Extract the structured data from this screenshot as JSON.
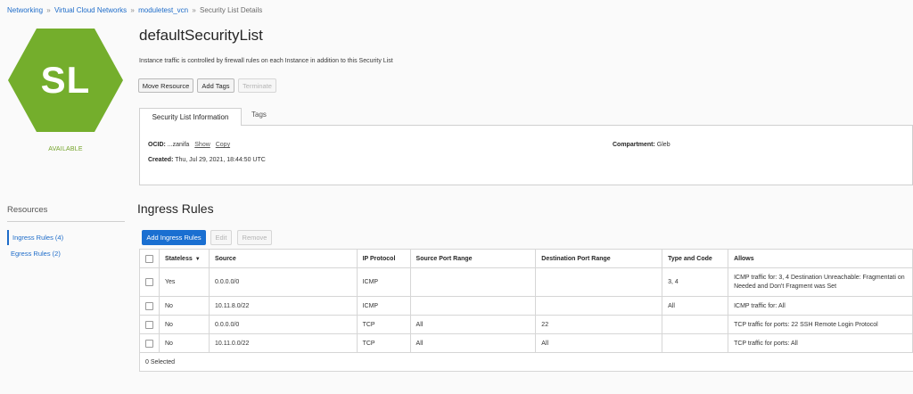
{
  "breadcrumb": {
    "items": [
      "Networking",
      "Virtual Cloud Networks",
      "moduletest_vcn"
    ],
    "current": "Security List Details",
    "separator": "»"
  },
  "logo": {
    "initials": "SL",
    "color": "#74ae2c",
    "status": "AVAILABLE"
  },
  "page": {
    "title": "defaultSecurityList",
    "description": "Instance traffic is controlled by firewall rules on each Instance in addition to this Security List"
  },
  "actions": {
    "move": "Move Resource",
    "add_tags": "Add Tags",
    "terminate": "Terminate"
  },
  "tabs": {
    "info": "Security List Information",
    "tags": "Tags"
  },
  "info": {
    "ocid_label": "OCID:",
    "ocid_value": "...zanifa",
    "show": "Show",
    "copy": "Copy",
    "created_label": "Created:",
    "created_value": "Thu, Jul 29, 2021, 18:44:50 UTC",
    "compartment_label": "Compartment:",
    "compartment_value": "Gleb"
  },
  "resources": {
    "title": "Resources",
    "items": [
      "Ingress Rules (4)",
      "Egress Rules (2)"
    ]
  },
  "ingress": {
    "title": "Ingress Rules",
    "add": "Add Ingress Rules",
    "edit": "Edit",
    "remove": "Remove",
    "columns": [
      "Stateless",
      "Source",
      "IP Protocol",
      "Source Port Range",
      "Destination Port Range",
      "Type and Code",
      "Allows"
    ],
    "rows": [
      [
        "Yes",
        "0.0.0.0/0",
        "ICMP",
        "",
        "",
        "3, 4",
        "ICMP traffic for: 3, 4 Destination Unreachable: Fragmentati on Needed and Don't Fragment was Set"
      ],
      [
        "No",
        "10.11.8.0/22",
        "ICMP",
        "",
        "",
        "All",
        "ICMP traffic for: All"
      ],
      [
        "No",
        "0.0.0.0/0",
        "TCP",
        "All",
        "22",
        "",
        "TCP traffic for ports: 22 SSH Remote Login Protocol"
      ],
      [
        "No",
        "10.11.0.0/22",
        "TCP",
        "All",
        "All",
        "",
        "TCP traffic for ports: All"
      ]
    ],
    "selected": "0 Selected"
  },
  "colors": {
    "accent": "#1a6fd1",
    "status_green": "#73a328",
    "link": "#1e6cc9"
  }
}
